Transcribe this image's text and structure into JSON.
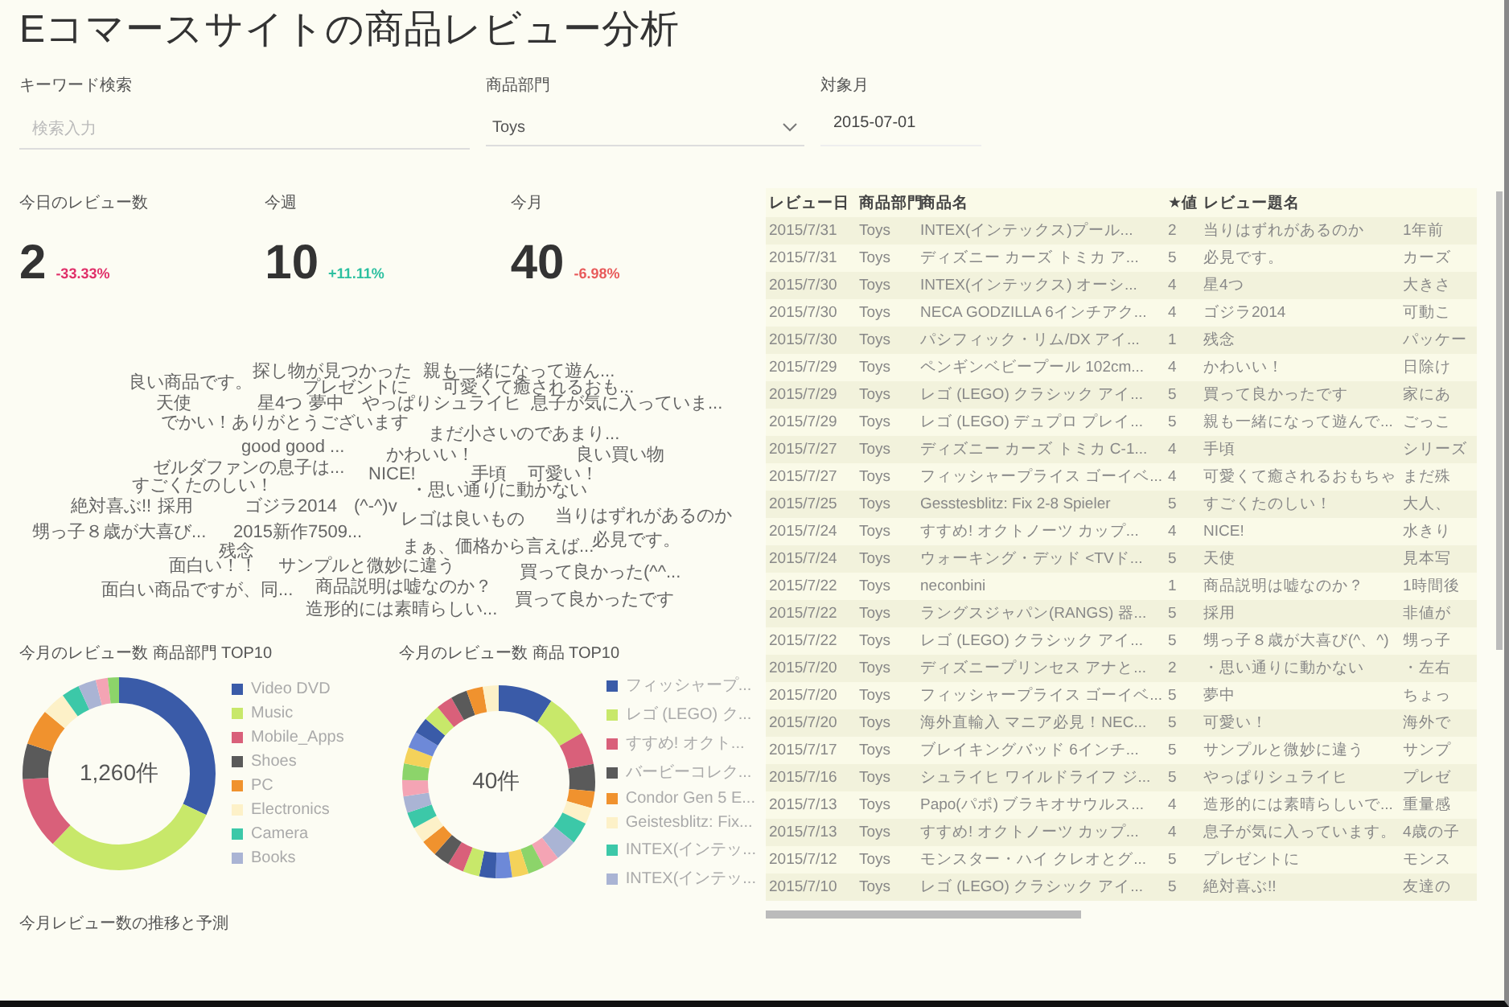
{
  "title": "Eコマースサイトの商品レビュー分析",
  "filters": {
    "keyword": {
      "label": "キーワード検索",
      "placeholder": "検索入力"
    },
    "category": {
      "label": "商品部門",
      "value": "Toys"
    },
    "month": {
      "label": "対象月",
      "value": "2015-07-01"
    }
  },
  "kpis": [
    {
      "label": "今日のレビュー数",
      "value": "2",
      "delta": "-33.33%",
      "color": "#e0306a"
    },
    {
      "label": "今週",
      "value": "10",
      "delta": "+11.11%",
      "color": "#2cc0a0"
    },
    {
      "label": "今月",
      "value": "40",
      "delta": "-6.98%",
      "color": "#e85a5a"
    }
  ],
  "word_cloud": [
    "良い商品です。",
    "探し物が見つかった",
    "親も一緒になって遊ん...",
    "プレゼントに",
    "可愛くて癒されるおも...",
    "天使",
    "星4つ",
    "夢中",
    "やっぱりシュライヒ",
    "息子が気に入っていま...",
    "でかい！ありがとうございます",
    "まだ小さいのであまり...",
    "good good ...",
    "かわいい！",
    "良い買い物",
    "ゼルダファンの息子は...",
    "NICE!",
    "手頃",
    "可愛い！",
    "すごくたのしい！",
    "・思い通りに動かない",
    "絶対喜ぶ!!",
    "採用",
    "ゴジラ2014",
    "(^-^)v",
    "レゴは良いもの",
    "当りはずれがあるのか",
    "甥っ子８歳が大喜び...",
    "2015新作7509...",
    "まぁ、価格から言えば...",
    "必見です。",
    "残念",
    "面白い！！",
    "サンプルと微妙に違う",
    "買って良かった(^^...",
    "面白い商品ですが、同...",
    "商品説明は嘘なのか？",
    "買って良かったです",
    "造形的には素晴らしい..."
  ],
  "donuts": [
    {
      "title": "今月のレビュー数 商品部門 TOP10",
      "center": "1,260件",
      "legend": [
        {
          "label": "Video DVD",
          "color": "#3a5ba8"
        },
        {
          "label": "Music",
          "color": "#c8e86a"
        },
        {
          "label": "Mobile_Apps",
          "color": "#d9607a"
        },
        {
          "label": "Shoes",
          "color": "#5a5a5a"
        },
        {
          "label": "PC",
          "color": "#f0922e"
        },
        {
          "label": "Electronics",
          "color": "#fdf1c8"
        },
        {
          "label": "Camera",
          "color": "#3cc8a8"
        },
        {
          "label": "Books",
          "color": "#aab4d4"
        }
      ]
    },
    {
      "title": "今月のレビュー数 商品 TOP10",
      "center": "40件",
      "legend": [
        {
          "label": "フィッシャープ...",
          "color": "#3a5ba8"
        },
        {
          "label": "レゴ (LEGO) ク...",
          "color": "#c8e86a"
        },
        {
          "label": "すすめ! オクト...",
          "color": "#d9607a"
        },
        {
          "label": "バービーコレク...",
          "color": "#5a5a5a"
        },
        {
          "label": "Condor Gen 5 E...",
          "color": "#f0922e"
        },
        {
          "label": "Geistesblitz: Fix...",
          "color": "#fdf1c8"
        },
        {
          "label": "INTEX(インテッ...",
          "color": "#3cc8a8"
        },
        {
          "label": "INTEX(インテッ...",
          "color": "#aab4d4"
        }
      ]
    }
  ],
  "trend_title": "今月レビュー数の推移と予測",
  "table": {
    "columns": [
      "レビュー日",
      "商品部門",
      "商品名",
      "★値",
      "レビュー題名"
    ],
    "rows": [
      [
        "2015/7/31",
        "Toys",
        "INTEX(インテックス)プール...",
        "2",
        "当りはずれがあるのか",
        "1年前"
      ],
      [
        "2015/7/31",
        "Toys",
        "ディズニー カーズ トミカ ア...",
        "5",
        "必見です。",
        "カーズ"
      ],
      [
        "2015/7/30",
        "Toys",
        "INTEX(インテックス) オーシ...",
        "4",
        "星4つ",
        "大きさ"
      ],
      [
        "2015/7/30",
        "Toys",
        "NECA GODZILLA 6インチアク...",
        "4",
        "ゴジラ2014",
        "可動こ"
      ],
      [
        "2015/7/30",
        "Toys",
        "パシフィック・リム/DX アイ...",
        "1",
        "残念",
        "パッケー"
      ],
      [
        "2015/7/29",
        "Toys",
        "ペンギンベビープール 102cm...",
        "4",
        "かわいい！",
        "日除け"
      ],
      [
        "2015/7/29",
        "Toys",
        "レゴ (LEGO) クラシック アイ...",
        "5",
        "買って良かったです",
        "家にあ"
      ],
      [
        "2015/7/29",
        "Toys",
        "レゴ (LEGO) デュプロ プレイ...",
        "5",
        "親も一緒になって遊んで...",
        "ごっこ"
      ],
      [
        "2015/7/27",
        "Toys",
        "ディズニー カーズ トミカ C-1...",
        "4",
        "手頃",
        "シリーズ"
      ],
      [
        "2015/7/27",
        "Toys",
        "フィッシャープライス ゴーイベ...",
        "4",
        "可愛くて癒されるおもちゃ",
        "まだ殊"
      ],
      [
        "2015/7/25",
        "Toys",
        "Gesstesblitz: Fix 2-8 Spieler",
        "5",
        "すごくたのしい！",
        "大人、"
      ],
      [
        "2015/7/24",
        "Toys",
        "すすめ! オクトノーツ カップ...",
        "4",
        "NICE!",
        "水きり"
      ],
      [
        "2015/7/24",
        "Toys",
        "ウォーキング・デッド <TVド...",
        "5",
        "天使",
        "見本写"
      ],
      [
        "2015/7/22",
        "Toys",
        "neconbini",
        "1",
        "商品説明は嘘なのか？",
        "1時間後"
      ],
      [
        "2015/7/22",
        "Toys",
        "ラングスジャパン(RANGS) 器...",
        "5",
        "採用",
        "非値が"
      ],
      [
        "2015/7/22",
        "Toys",
        "レゴ (LEGO) クラシック アイ...",
        "5",
        "甥っ子８歳が大喜び(^、^)",
        "甥っ子"
      ],
      [
        "2015/7/20",
        "Toys",
        "ディズニープリンセス アナと...",
        "2",
        "・思い通りに動かない",
        "・左右"
      ],
      [
        "2015/7/20",
        "Toys",
        "フィッシャープライス ゴーイベ...",
        "5",
        "夢中",
        "ちょっ"
      ],
      [
        "2015/7/20",
        "Toys",
        "海外直輸入 マニア必見！NEC...",
        "5",
        "可愛い！",
        "海外で"
      ],
      [
        "2015/7/17",
        "Toys",
        "ブレイキングバッド 6インチ...",
        "5",
        "サンプルと微妙に違う",
        "サンプ"
      ],
      [
        "2015/7/16",
        "Toys",
        "シュライヒ ワイルドライフ ジ...",
        "5",
        "やっぱりシュライヒ",
        "プレゼ"
      ],
      [
        "2015/7/13",
        "Toys",
        "Papo(パポ) ブラキオサウルス...",
        "4",
        "造形的には素晴らしいで...",
        "重量感"
      ],
      [
        "2015/7/13",
        "Toys",
        "すすめ! オクトノーツ カップ...",
        "4",
        "息子が気に入っています。",
        "4歳の子"
      ],
      [
        "2015/7/12",
        "Toys",
        "モンスター・ハイ クレオとグ...",
        "5",
        "プレゼントに",
        "モンス"
      ],
      [
        "2015/7/10",
        "Toys",
        "レゴ (LEGO) クラシック アイ...",
        "5",
        "絶対喜ぶ!!",
        "友達の"
      ]
    ]
  }
}
